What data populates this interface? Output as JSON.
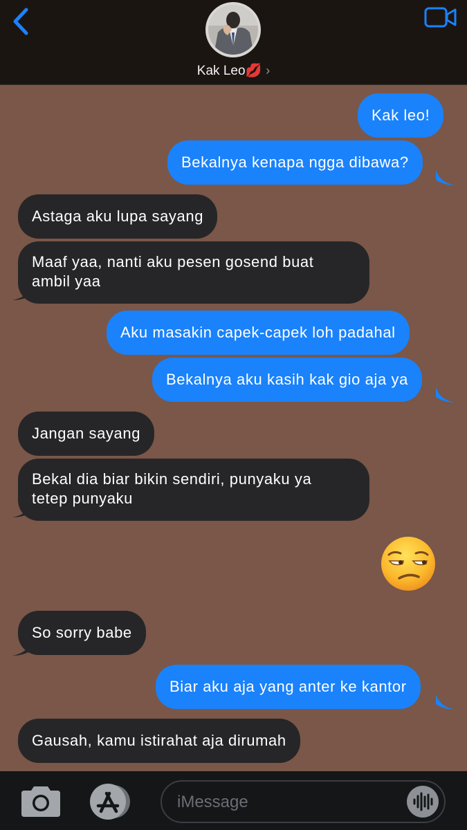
{
  "header": {
    "contact_name": "Kak Leo💋",
    "chevron": "›",
    "icons": {
      "back": "chevron-left-icon",
      "video": "video-camera-icon"
    },
    "accent_color": "#1a82fb"
  },
  "messages": [
    {
      "direction": "outgoing",
      "text": "Kak leo!"
    },
    {
      "direction": "outgoing",
      "text": "Bekalnya kenapa ngga dibawa?"
    },
    {
      "direction": "incoming",
      "text": "Astaga aku lupa sayang"
    },
    {
      "direction": "incoming",
      "lines": [
        "Maaf yaa, nanti aku pesen gosend buat",
        "ambil yaa"
      ]
    },
    {
      "direction": "outgoing",
      "text": "Aku masakin capek-capek loh padahal"
    },
    {
      "direction": "outgoing",
      "text": "Bekalnya aku kasih kak gio aja ya"
    },
    {
      "direction": "incoming",
      "text": "Jangan sayang"
    },
    {
      "direction": "incoming",
      "lines": [
        "Bekal dia biar bikin sendiri, punyaku ya",
        "tetep punyaku"
      ]
    },
    {
      "direction": "outgoing",
      "emoji": "unamused-face"
    },
    {
      "direction": "incoming",
      "text": "So sorry babe"
    },
    {
      "direction": "outgoing",
      "text": "Biar aku aja yang anter ke kantor"
    },
    {
      "direction": "incoming",
      "text": "Gausah, kamu istirahat aja dirumah"
    }
  ],
  "colors": {
    "outgoing_bubble": "#1a82fb",
    "incoming_bubble": "#262628",
    "background": "#7a5748"
  },
  "input_bar": {
    "placeholder": "iMessage",
    "icons": {
      "camera": "camera-icon",
      "app_store": "app-store-icon",
      "audio": "audio-waveform-icon"
    }
  }
}
